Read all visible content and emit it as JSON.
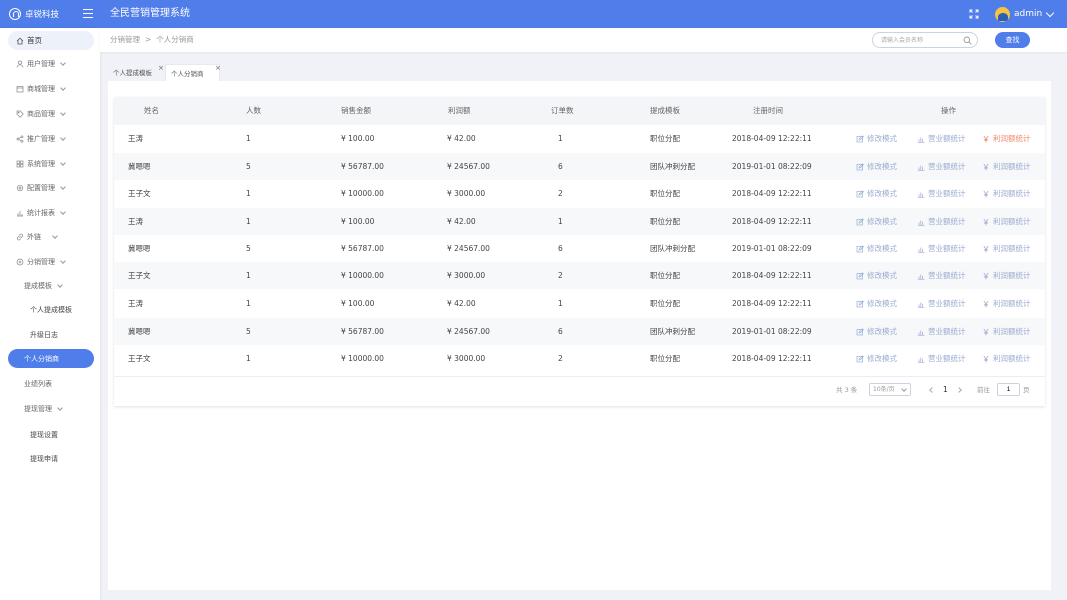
{
  "header": {
    "brand": "卓锐科技",
    "app_title": "全民营销管理系统",
    "username": "admin"
  },
  "sidebar": {
    "home": "首页",
    "items": [
      {
        "label": "用户管理",
        "icon": "user-icon"
      },
      {
        "label": "商城管理",
        "icon": "store-icon"
      },
      {
        "label": "商品管理",
        "icon": "tag-icon"
      },
      {
        "label": "推广管理",
        "icon": "share-icon"
      },
      {
        "label": "系统管理",
        "icon": "grid-icon"
      },
      {
        "label": "配置管理",
        "icon": "gear-icon"
      },
      {
        "label": "统计报表",
        "icon": "bar-chart-icon"
      },
      {
        "label": "外链",
        "icon": "link-icon"
      },
      {
        "label": "分销管理",
        "icon": "distribution-icon"
      }
    ],
    "distribution_sub": {
      "commission_template": "提成模板",
      "personal_commission_template": "个人提成模板",
      "upgrade_log": "升级日志",
      "personal_distributor": "个人分销商",
      "performance_list": "业绩列表",
      "withdraw_management": "提现管理",
      "withdraw_settings": "提现设置",
      "withdraw_application": "提现申请"
    }
  },
  "breadcrumb": {
    "parent": "分销管理",
    "separator": ">",
    "current": "个人分销商"
  },
  "search": {
    "placeholder": "请输入会员名称",
    "button": "查找"
  },
  "tabs": [
    {
      "label": "个人提成模板",
      "close": "×"
    },
    {
      "label": "个人分销商",
      "close": "×"
    }
  ],
  "table": {
    "headers": {
      "name": "姓名",
      "people": "人数",
      "sales": "销售金额",
      "profit": "利润额",
      "orders": "订单数",
      "template": "提成模板",
      "registered": "注册时间",
      "actions": "操作"
    },
    "actions": {
      "edit": "修改模式",
      "revenue": "营业额统计",
      "profit_stats": "利润额统计"
    },
    "rows": [
      {
        "name": "王涛",
        "people": "1",
        "sales": "¥ 100.00",
        "profit": "¥ 42.00",
        "orders": "1",
        "template": "职位分配",
        "registered": "2018-04-09  12:22:11"
      },
      {
        "name": "冀嗯嗯",
        "people": "5",
        "sales": "¥ 56787.00",
        "profit": "¥ 24567.00",
        "orders": "6",
        "template": "团队冲刺分配",
        "registered": "2019-01-01  08:22:09"
      },
      {
        "name": "王子文",
        "people": "1",
        "sales": "¥ 10000.00",
        "profit": "¥ 3000.00",
        "orders": "2",
        "template": "职位分配",
        "registered": "2018-04-09  12:22:11"
      },
      {
        "name": "王涛",
        "people": "1",
        "sales": "¥ 100.00",
        "profit": "¥ 42.00",
        "orders": "1",
        "template": "职位分配",
        "registered": "2018-04-09  12:22:11"
      },
      {
        "name": "冀嗯嗯",
        "people": "5",
        "sales": "¥ 56787.00",
        "profit": "¥ 24567.00",
        "orders": "6",
        "template": "团队冲刺分配",
        "registered": "2019-01-01  08:22:09"
      },
      {
        "name": "王子文",
        "people": "1",
        "sales": "¥ 10000.00",
        "profit": "¥ 3000.00",
        "orders": "2",
        "template": "职位分配",
        "registered": "2018-04-09  12:22:11"
      },
      {
        "name": "王涛",
        "people": "1",
        "sales": "¥ 100.00",
        "profit": "¥ 42.00",
        "orders": "1",
        "template": "职位分配",
        "registered": "2018-04-09  12:22:11"
      },
      {
        "name": "冀嗯嗯",
        "people": "5",
        "sales": "¥ 56787.00",
        "profit": "¥ 24567.00",
        "orders": "6",
        "template": "团队冲刺分配",
        "registered": "2019-01-01  08:22:09"
      },
      {
        "name": "王子文",
        "people": "1",
        "sales": "¥ 10000.00",
        "profit": "¥ 3000.00",
        "orders": "2",
        "template": "职位分配",
        "registered": "2018-04-09  12:22:11"
      }
    ]
  },
  "pagination": {
    "total": "共 3 条",
    "page_size": "10条/页",
    "current_page": "1",
    "goto_label": "前往",
    "goto_value": "1",
    "page_unit": "页"
  },
  "colors": {
    "primary": "#4f7de9",
    "action": "#9aabd0",
    "action_highlight": "#f08b6a"
  }
}
